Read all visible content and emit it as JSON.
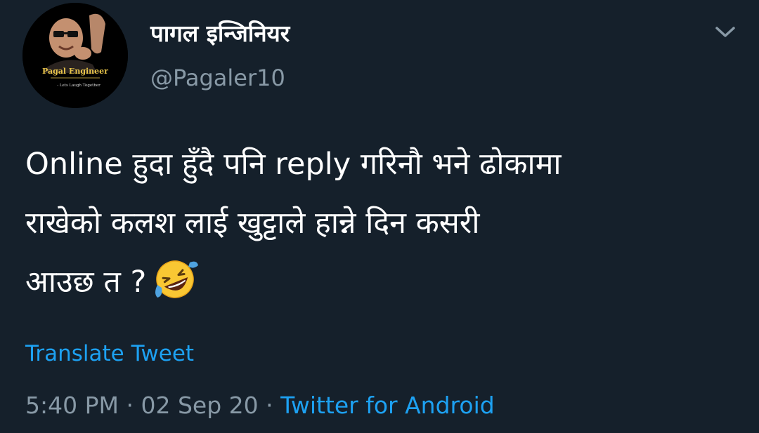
{
  "user": {
    "display_name": "पागल इन्जिनियर",
    "handle": "@Pagaler10",
    "avatar_text": "Pagal Engineer",
    "avatar_subtext": "- Lets Laugh Together"
  },
  "tweet": {
    "lines": [
      "Online हुदा हुँदै पनि reply गरिनौ भने ढोकामा",
      "राखेको कलश लाई खुट्टाले हान्ने दिन कसरी",
      "आउछ त ?"
    ],
    "emoji": "rolling-on-floor-laughing-emoji"
  },
  "translate_label": "Translate Tweet",
  "meta": {
    "time": "5:40 PM",
    "separator": "·",
    "date": "02 Sep 20",
    "source": "Twitter for Android"
  },
  "icons": {
    "menu": "chevron-down-icon"
  },
  "colors": {
    "background": "#15202b",
    "text": "#ffffff",
    "secondary": "#8899a6",
    "accent": "#1da1f2"
  }
}
